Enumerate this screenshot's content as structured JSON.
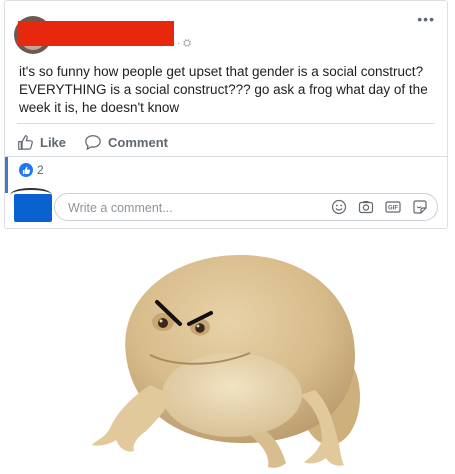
{
  "post": {
    "meta": "· ⛭",
    "more": "•••",
    "text": "it's so funny how people get upset that gender is a social construct? EVERYTHING is a social construct??? go ask a frog what day of the week it is, he doesn't know"
  },
  "actions": {
    "like_label": "Like",
    "comment_label": "Comment"
  },
  "reactions": {
    "count": "2"
  },
  "composer": {
    "placeholder": "Write a comment...",
    "tools": [
      "emoji-icon",
      "camera-icon",
      "gif-icon",
      "sticker-icon"
    ]
  },
  "colors": {
    "like_blue": "#2078f4",
    "redaction_red": "#e8270f",
    "avatar_blue": "#0a62d0"
  }
}
